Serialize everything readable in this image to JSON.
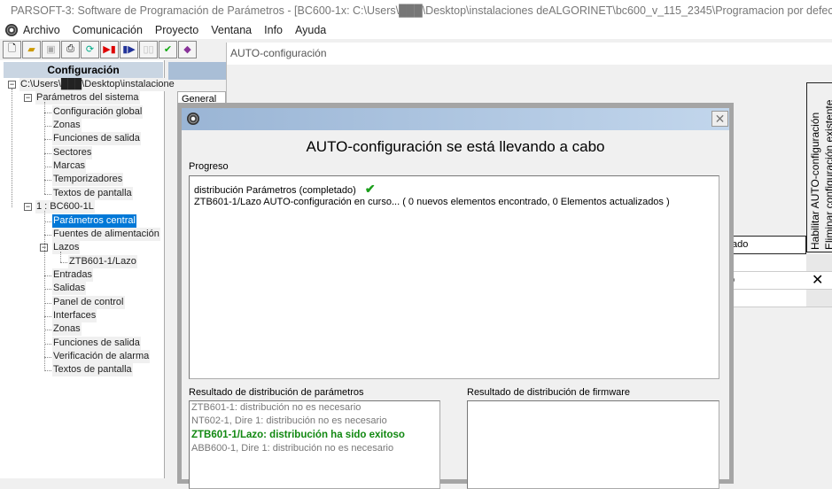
{
  "window": {
    "title": "PARSOFT-3: Software de Programación de Parámetros - [BC600-1x: C:\\Users\\███\\Desktop\\instalaciones deALGORINET\\bc600_v_115_2345\\Programacion por defecto.PAR]"
  },
  "menu": [
    "Archivo",
    "Comunicación",
    "Proyecto",
    "Ventana",
    "Info",
    "Ayuda"
  ],
  "toolbar": [
    "new-icon",
    "open-icon",
    "save-icon",
    "print-icon",
    "sync-icon",
    "upload-icon",
    "download-icon",
    "compare-icon",
    "autoconfig-icon",
    "help-book-icon"
  ],
  "sidebar": {
    "title": "Configuración",
    "root": "C:\\Users\\███\\Desktop\\instalacione",
    "system": {
      "label": "Parámetros del sistema",
      "items": [
        "Configuración global",
        "Zonas",
        "Funciones de salida",
        "Sectores",
        "Marcas",
        "Temporizadores",
        "Textos de pantalla"
      ]
    },
    "panel": {
      "label": "1 : BC600-1L",
      "items": [
        "Parámetros central",
        "Fuentes de alimentación",
        "Lazos",
        "ZTB601-1/Lazo",
        "Entradas",
        "Salidas",
        "Panel de control",
        "Interfaces",
        "Zonas",
        "Funciones de salida",
        "Verificación de alarma",
        "Textos de pantalla"
      ],
      "selected": "Parámetros central"
    }
  },
  "background": {
    "tab_general": "General",
    "auto_window_title": "AUTO-configuración",
    "col_enable": "Habilitar AUTO-configuración",
    "col_delete": "Eliminar configuración existente",
    "col_state": "tado",
    "row2_cell": "o",
    "row2_mark": "✕"
  },
  "dialog": {
    "heading": "AUTO-configuración se está llevando a cabo",
    "progress_label": "Progreso",
    "progress_lines": [
      "distribución Parámetros (completado)",
      "ZTB601-1/Lazo AUTO-configuración en curso... ( 0 nuevos elementos encontrado, 0 Elementos actualizados )"
    ],
    "check": "✔",
    "param_label": "Resultado de distribución de parámetros",
    "param_results": [
      {
        "text": "ZTB601-1: distribución no es necesario",
        "status": "skipped"
      },
      {
        "text": "NT602-1, Dire 1: distribución no es necesario",
        "status": "skipped"
      },
      {
        "text": "ZTB601-1/Lazo: distribución ha sido exitoso",
        "status": "success"
      },
      {
        "text": "ABB600-1, Dire 1: distribución no es necesario",
        "status": "skipped"
      }
    ],
    "firmware_label": "Resultado de distribución de firmware",
    "close": "✕"
  },
  "colors": {
    "success": "#118811",
    "skipped": "#777777",
    "selection": "#0078d7",
    "titlebar_blue": "#a9bed6"
  }
}
